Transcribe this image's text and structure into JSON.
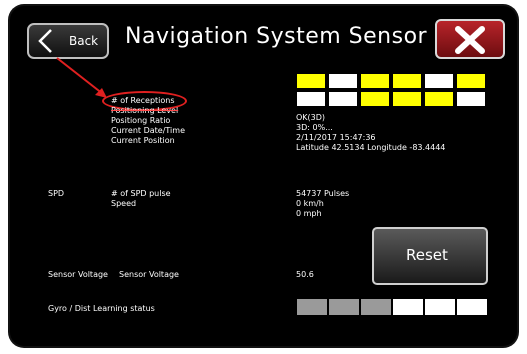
{
  "header": {
    "back_label": "Back",
    "title": "Navigation System Sensor",
    "close_icon": "close-icon",
    "back_icon": "chevron-left-icon"
  },
  "gps": {
    "labels": [
      "# of Receptions",
      "Positioning Level",
      "Positiong Ratio",
      "Current Date/Time",
      "Current Position"
    ],
    "values": [
      "OK(3D)",
      "3D: 0%...",
      "2/11/2017   15:47:36",
      "Latitude 42.5134 Longitude -83.4444"
    ],
    "reception_grid": {
      "row1": [
        "yellow",
        "white",
        "yellow",
        "yellow",
        "white",
        "yellow"
      ],
      "row2": [
        "white",
        "white",
        "yellow",
        "yellow",
        "yellow",
        "white"
      ]
    }
  },
  "spd": {
    "section": "SPD",
    "labels": [
      "# of SPD pulse",
      "Speed"
    ],
    "values": [
      "54737 Pulses",
      "0 km/h",
      "0 mph"
    ],
    "reset_label": "Reset"
  },
  "sensor": {
    "section": "Sensor Voltage",
    "label": "Sensor Voltage",
    "value": "50.6"
  },
  "gyro": {
    "label": "Gyro / Dist Learning status",
    "cells": [
      "gray",
      "gray",
      "gray",
      "white",
      "white",
      "white"
    ]
  },
  "colors": {
    "yellow": "#ffff00",
    "white": "#ffffff",
    "gray": "#9a9a9a",
    "accent_red": "#e02020"
  }
}
